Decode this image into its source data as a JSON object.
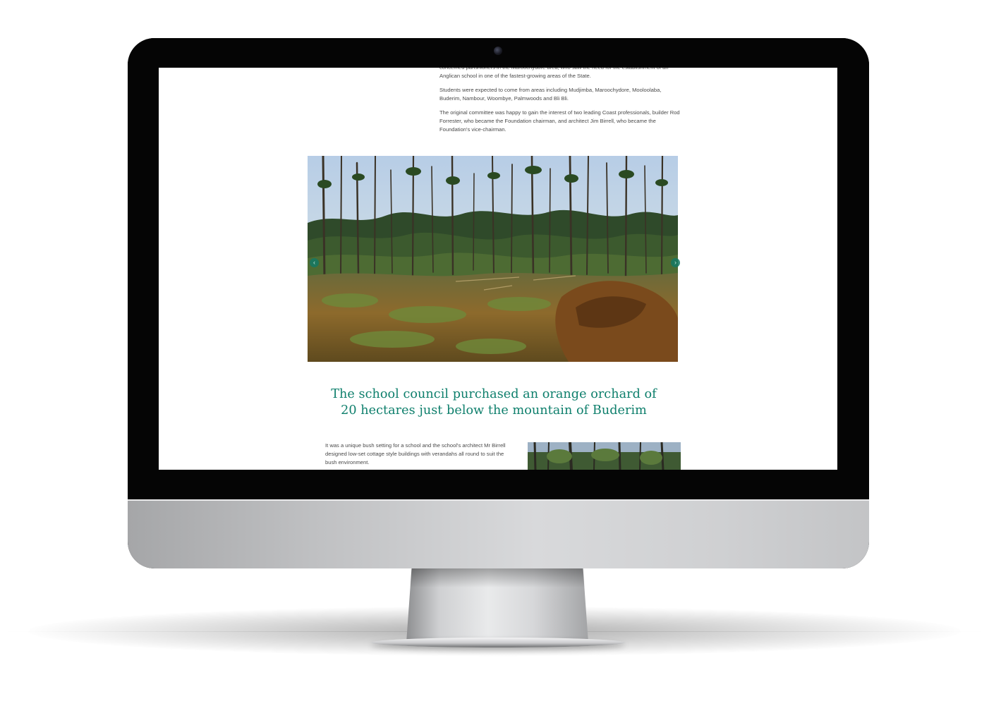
{
  "article": {
    "intro_fragment": "concerned parishioners in the Maroochydore area, who saw the need for the establishment of an Anglican school in one of the fastest-growing areas of the State.",
    "paragraph_students": "Students were expected to come from areas including Mudjimba, Maroochydore, Mooloolaba, Buderim, Nambour, Woombye, Palmwoods and Bli Bli.",
    "paragraph_committee": "The original committee was happy to gain the interest of two leading Coast professionals, builder Rod Forrester, who became the Foundation chairman, and architect Jim Birrell, who became the Foundation's vice-chairman.",
    "headline_line1": "The school council purchased an orange orchard of",
    "headline_line2": "20 hectares just below the mountain of Buderim",
    "paragraph_bush": "It was a unique bush setting for a school and the school's architect Mr Birrell designed low-set cottage style buildings with verandahs all round to suit the bush environment."
  },
  "gallery": {
    "prev_icon": "chevron-left-icon",
    "next_icon": "chevron-right-icon",
    "prev_glyph": "‹",
    "next_glyph": "›",
    "image_subject": "cleared bushland with tall pine trees"
  },
  "colors": {
    "accent": "#0e7f6c",
    "body_text": "#4a4a4a",
    "screen_background": "#ffffff",
    "bezel": "#050505",
    "chin": "#cfd0d2"
  }
}
